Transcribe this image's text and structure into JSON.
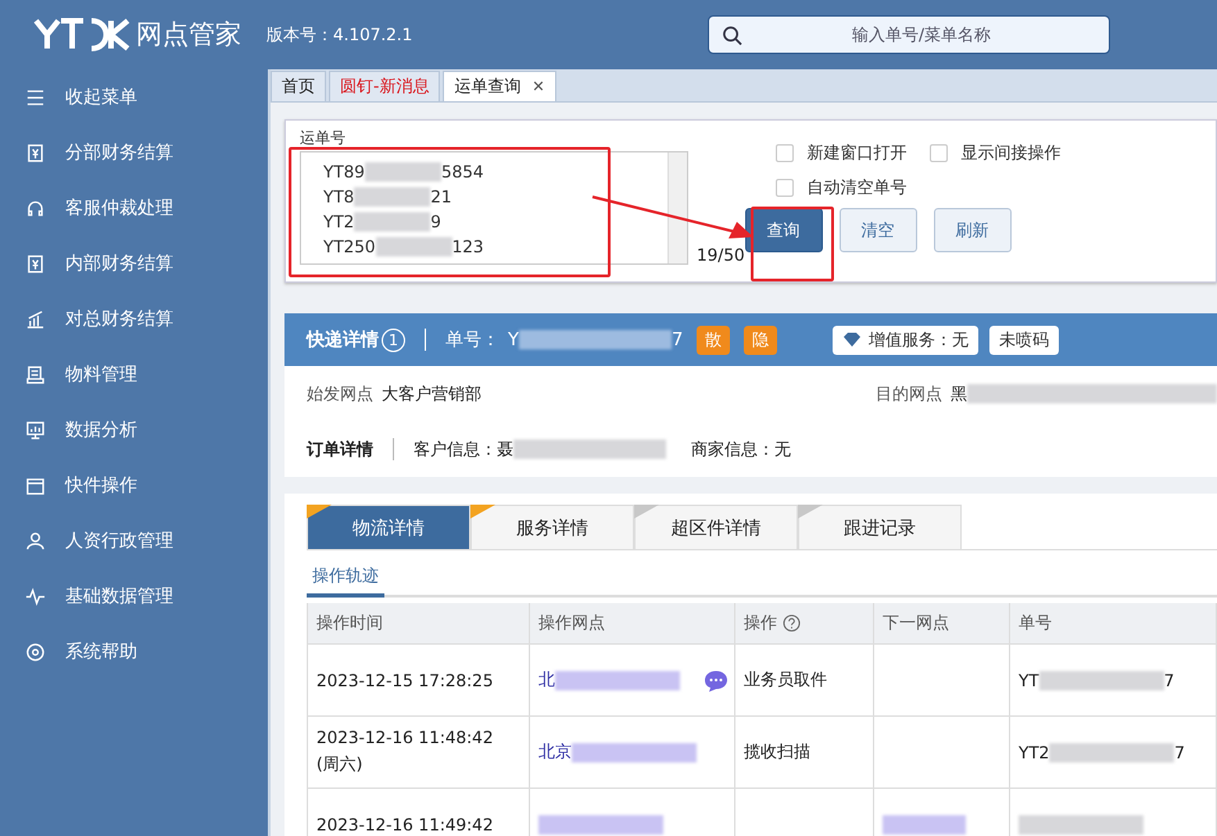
{
  "header": {
    "brand": "网点管家",
    "version": "版本号：4.107.2.1",
    "search_placeholder": "输入单号/菜单名称"
  },
  "sidebar": {
    "items": [
      {
        "label": "收起菜单"
      },
      {
        "label": "分部财务结算"
      },
      {
        "label": "客服仲裁处理"
      },
      {
        "label": "内部财务结算"
      },
      {
        "label": "对总财务结算"
      },
      {
        "label": "物料管理"
      },
      {
        "label": "数据分析"
      },
      {
        "label": "快件操作"
      },
      {
        "label": "人资行政管理"
      },
      {
        "label": "基础数据管理"
      },
      {
        "label": "系统帮助"
      }
    ]
  },
  "page_tabs": [
    {
      "label": "首页",
      "selected": false,
      "alert": false,
      "closable": false
    },
    {
      "label": "圆钉-新消息",
      "selected": false,
      "alert": true,
      "closable": false
    },
    {
      "label": "运单查询",
      "selected": true,
      "alert": false,
      "closable": true
    }
  ],
  "close_glyph": "✕",
  "query": {
    "label": "运单号",
    "lines": [
      [
        {
          "kind": "text",
          "text": "YT89"
        },
        {
          "kind": "blur"
        },
        {
          "kind": "text",
          "text": "5854"
        }
      ],
      [
        {
          "kind": "text",
          "text": "YT8"
        },
        {
          "kind": "blur"
        },
        {
          "kind": "text",
          "text": "21"
        }
      ],
      [
        {
          "kind": "text",
          "text": "YT2"
        },
        {
          "kind": "blur"
        },
        {
          "kind": "text",
          "text": "9"
        }
      ],
      [
        {
          "kind": "text",
          "text": "YT250"
        },
        {
          "kind": "blur"
        },
        {
          "kind": "text",
          "text": "123"
        }
      ]
    ],
    "count": "19/50",
    "options": [
      {
        "label": "新建窗口打开",
        "checked": false
      },
      {
        "label": "显示间接操作",
        "checked": false
      },
      {
        "label": "自动清空单号",
        "checked": false
      }
    ],
    "buttons": [
      {
        "label": "查询",
        "primary": true
      },
      {
        "label": "清空",
        "primary": false
      },
      {
        "label": "刷新",
        "primary": false
      }
    ]
  },
  "detail": {
    "title": "快递详情",
    "badge": "1",
    "number_label": "单号：",
    "number": [
      {
        "kind": "text",
        "text": "Y"
      },
      {
        "kind": "blur"
      },
      {
        "kind": "text",
        "text": "7"
      }
    ],
    "tags": [
      "散",
      "隐"
    ],
    "service": "增值服务：无",
    "code_status": "未喷码",
    "origin_label": "始发网点",
    "origin": "大客户营销部",
    "dest_label": "目的网点",
    "dest": [
      {
        "kind": "text",
        "text": "黑"
      },
      {
        "kind": "blur"
      }
    ],
    "order_title": "订单详情",
    "customer_label": "客户信息：",
    "customer": [
      {
        "kind": "text",
        "text": "聂"
      },
      {
        "kind": "blur"
      }
    ],
    "merchant": "商家信息：无"
  },
  "detail_tabs": [
    {
      "label": "物流详情",
      "selected": true,
      "flag": true
    },
    {
      "label": "服务详情",
      "selected": false,
      "flag": true
    },
    {
      "label": "超区件详情",
      "selected": false,
      "flag": false
    },
    {
      "label": "跟进记录",
      "selected": false,
      "flag": false
    }
  ],
  "sub_tab": "操作轨迹",
  "table": {
    "columns": [
      "操作时间",
      "操作网点",
      "操作",
      "下一网点",
      "单号"
    ],
    "rows": [
      {
        "time": [
          "2023-12-15 17:28:25"
        ],
        "site": [
          {
            "kind": "text",
            "text": "北"
          },
          {
            "kind": "blur"
          }
        ],
        "chat": true,
        "op": "业务员取件",
        "next": [],
        "number": [
          {
            "kind": "text",
            "text": "YT"
          },
          {
            "kind": "blur"
          },
          {
            "kind": "text",
            "text": "7"
          }
        ]
      },
      {
        "time": [
          "2023-12-16 11:48:42",
          "(周六)"
        ],
        "site": [
          {
            "kind": "text",
            "text": "北京"
          },
          {
            "kind": "blur"
          }
        ],
        "chat": false,
        "op": "揽收扫描",
        "next": [],
        "number": [
          {
            "kind": "text",
            "text": "YT2"
          },
          {
            "kind": "blur"
          },
          {
            "kind": "text",
            "text": "7"
          }
        ]
      },
      {
        "time": [
          "2023-12-16 11:49:42"
        ],
        "site": [
          {
            "kind": "blur"
          }
        ],
        "chat": false,
        "op": "",
        "next": [
          {
            "kind": "blur"
          }
        ],
        "number": [
          {
            "kind": "blur"
          }
        ]
      }
    ]
  }
}
